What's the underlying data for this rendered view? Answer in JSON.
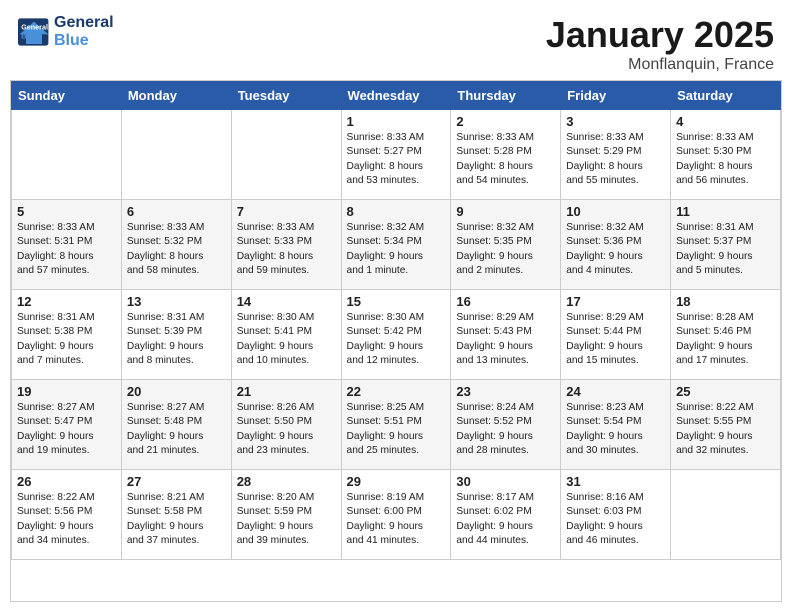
{
  "header": {
    "logo_line1": "General",
    "logo_line2": "Blue",
    "main_title": "January 2025",
    "sub_title": "Monflanquin, France"
  },
  "weekdays": [
    "Sunday",
    "Monday",
    "Tuesday",
    "Wednesday",
    "Thursday",
    "Friday",
    "Saturday"
  ],
  "weeks": [
    [
      {
        "day": "",
        "info": ""
      },
      {
        "day": "",
        "info": ""
      },
      {
        "day": "",
        "info": ""
      },
      {
        "day": "1",
        "info": "Sunrise: 8:33 AM\nSunset: 5:27 PM\nDaylight: 8 hours\nand 53 minutes."
      },
      {
        "day": "2",
        "info": "Sunrise: 8:33 AM\nSunset: 5:28 PM\nDaylight: 8 hours\nand 54 minutes."
      },
      {
        "day": "3",
        "info": "Sunrise: 8:33 AM\nSunset: 5:29 PM\nDaylight: 8 hours\nand 55 minutes."
      },
      {
        "day": "4",
        "info": "Sunrise: 8:33 AM\nSunset: 5:30 PM\nDaylight: 8 hours\nand 56 minutes."
      }
    ],
    [
      {
        "day": "5",
        "info": "Sunrise: 8:33 AM\nSunset: 5:31 PM\nDaylight: 8 hours\nand 57 minutes."
      },
      {
        "day": "6",
        "info": "Sunrise: 8:33 AM\nSunset: 5:32 PM\nDaylight: 8 hours\nand 58 minutes."
      },
      {
        "day": "7",
        "info": "Sunrise: 8:33 AM\nSunset: 5:33 PM\nDaylight: 8 hours\nand 59 minutes."
      },
      {
        "day": "8",
        "info": "Sunrise: 8:32 AM\nSunset: 5:34 PM\nDaylight: 9 hours\nand 1 minute."
      },
      {
        "day": "9",
        "info": "Sunrise: 8:32 AM\nSunset: 5:35 PM\nDaylight: 9 hours\nand 2 minutes."
      },
      {
        "day": "10",
        "info": "Sunrise: 8:32 AM\nSunset: 5:36 PM\nDaylight: 9 hours\nand 4 minutes."
      },
      {
        "day": "11",
        "info": "Sunrise: 8:31 AM\nSunset: 5:37 PM\nDaylight: 9 hours\nand 5 minutes."
      }
    ],
    [
      {
        "day": "12",
        "info": "Sunrise: 8:31 AM\nSunset: 5:38 PM\nDaylight: 9 hours\nand 7 minutes."
      },
      {
        "day": "13",
        "info": "Sunrise: 8:31 AM\nSunset: 5:39 PM\nDaylight: 9 hours\nand 8 minutes."
      },
      {
        "day": "14",
        "info": "Sunrise: 8:30 AM\nSunset: 5:41 PM\nDaylight: 9 hours\nand 10 minutes."
      },
      {
        "day": "15",
        "info": "Sunrise: 8:30 AM\nSunset: 5:42 PM\nDaylight: 9 hours\nand 12 minutes."
      },
      {
        "day": "16",
        "info": "Sunrise: 8:29 AM\nSunset: 5:43 PM\nDaylight: 9 hours\nand 13 minutes."
      },
      {
        "day": "17",
        "info": "Sunrise: 8:29 AM\nSunset: 5:44 PM\nDaylight: 9 hours\nand 15 minutes."
      },
      {
        "day": "18",
        "info": "Sunrise: 8:28 AM\nSunset: 5:46 PM\nDaylight: 9 hours\nand 17 minutes."
      }
    ],
    [
      {
        "day": "19",
        "info": "Sunrise: 8:27 AM\nSunset: 5:47 PM\nDaylight: 9 hours\nand 19 minutes."
      },
      {
        "day": "20",
        "info": "Sunrise: 8:27 AM\nSunset: 5:48 PM\nDaylight: 9 hours\nand 21 minutes."
      },
      {
        "day": "21",
        "info": "Sunrise: 8:26 AM\nSunset: 5:50 PM\nDaylight: 9 hours\nand 23 minutes."
      },
      {
        "day": "22",
        "info": "Sunrise: 8:25 AM\nSunset: 5:51 PM\nDaylight: 9 hours\nand 25 minutes."
      },
      {
        "day": "23",
        "info": "Sunrise: 8:24 AM\nSunset: 5:52 PM\nDaylight: 9 hours\nand 28 minutes."
      },
      {
        "day": "24",
        "info": "Sunrise: 8:23 AM\nSunset: 5:54 PM\nDaylight: 9 hours\nand 30 minutes."
      },
      {
        "day": "25",
        "info": "Sunrise: 8:22 AM\nSunset: 5:55 PM\nDaylight: 9 hours\nand 32 minutes."
      }
    ],
    [
      {
        "day": "26",
        "info": "Sunrise: 8:22 AM\nSunset: 5:56 PM\nDaylight: 9 hours\nand 34 minutes."
      },
      {
        "day": "27",
        "info": "Sunrise: 8:21 AM\nSunset: 5:58 PM\nDaylight: 9 hours\nand 37 minutes."
      },
      {
        "day": "28",
        "info": "Sunrise: 8:20 AM\nSunset: 5:59 PM\nDaylight: 9 hours\nand 39 minutes."
      },
      {
        "day": "29",
        "info": "Sunrise: 8:19 AM\nSunset: 6:00 PM\nDaylight: 9 hours\nand 41 minutes."
      },
      {
        "day": "30",
        "info": "Sunrise: 8:17 AM\nSunset: 6:02 PM\nDaylight: 9 hours\nand 44 minutes."
      },
      {
        "day": "31",
        "info": "Sunrise: 8:16 AM\nSunset: 6:03 PM\nDaylight: 9 hours\nand 46 minutes."
      },
      {
        "day": "",
        "info": ""
      }
    ]
  ]
}
